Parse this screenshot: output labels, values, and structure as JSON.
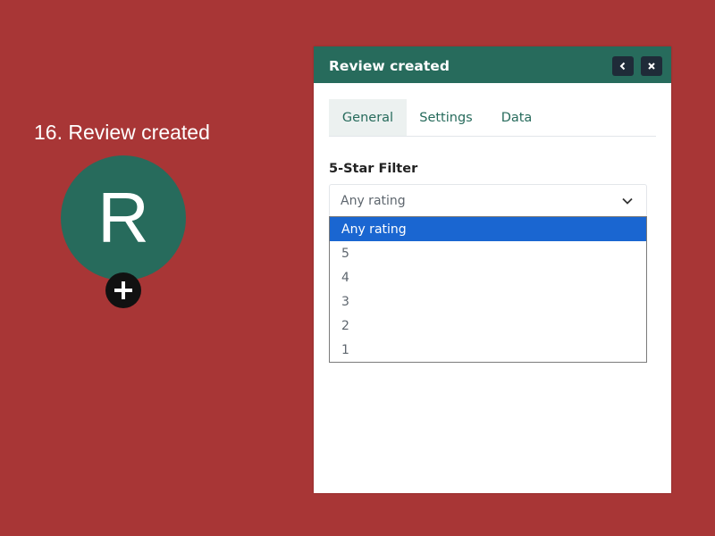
{
  "node": {
    "title": "16. Review created",
    "letter": "R",
    "circle_color": "#276b5c",
    "add_icon": "plus-icon"
  },
  "panel": {
    "title": "Review created",
    "header_color": "#276b5c",
    "back_icon": "chevron-left-icon",
    "close_icon": "close-icon",
    "tabs": [
      {
        "label": "General",
        "active": true
      },
      {
        "label": "Settings",
        "active": false
      },
      {
        "label": "Data",
        "active": false
      }
    ],
    "filter": {
      "label": "5-Star Filter",
      "selected": "Any rating",
      "options": [
        "Any rating",
        "5",
        "4",
        "3",
        "2",
        "1"
      ],
      "highlight_color": "#1a66d1"
    }
  },
  "background_color": "#a83636"
}
